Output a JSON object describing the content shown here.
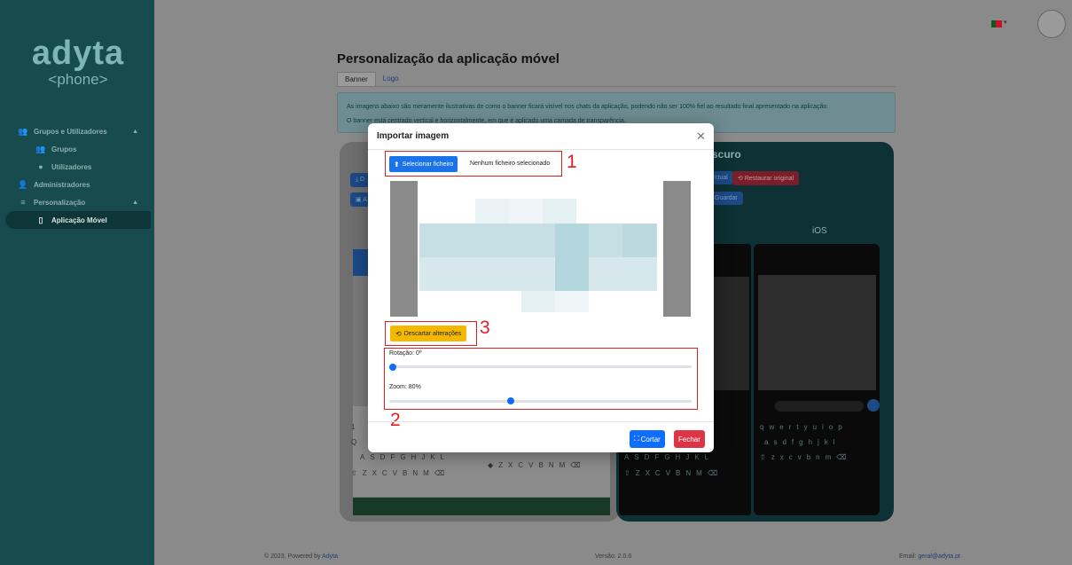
{
  "sidebar": {
    "logo_brand": "adyta",
    "logo_sub": "<phone>",
    "items": [
      {
        "label": "Grupos e Utilizadores",
        "icon": "users-icon"
      },
      {
        "label": "Grupos",
        "icon": "group-icon"
      },
      {
        "label": "Utilizadores",
        "icon": "user-icon"
      },
      {
        "label": "Administradores",
        "icon": "admin-icon"
      },
      {
        "label": "Personalização",
        "icon": "sliders-icon"
      },
      {
        "label": "Aplicação Móvel",
        "icon": "mobile-icon"
      }
    ]
  },
  "header": {
    "title": "Personalização da aplicação móvel",
    "tabs": [
      {
        "label": "Banner"
      },
      {
        "label": "Logo"
      }
    ]
  },
  "info": {
    "line1": "As imagens abaixo são meramente ilustrativas de como o banner ficará visível nos chats da aplicação, podendo não ser 100% fiel ao resultado final apresentado na aplicação.",
    "line2": "O banner está centrado vertical e horizontalmente, em que é aplicado uma camada de transparência."
  },
  "preview": {
    "dark_title": "Modo escuro",
    "ios_title": "iOS",
    "btn_current": "ctual",
    "btn_restore": "Restaurar original",
    "btn_save": "Guardar",
    "btn_d": "D",
    "btn_a": "A"
  },
  "modal": {
    "title": "Importar imagem",
    "file_button": "Selecionar ficheiro",
    "file_status": "Nenhum ficheiro selecionado",
    "discard_button": "Descartar alterações",
    "rotation_label": "Rotação: 0º",
    "rotation_value": 0,
    "zoom_label": "Zoom: 80%",
    "zoom_value": 80,
    "crop_button": "Cortar",
    "close_button": "Fechar",
    "annotations": [
      "1",
      "2",
      "3"
    ]
  },
  "footer": {
    "copyright": "© 2023, Powered by",
    "brand_link": "Adyta",
    "version": "Versão: 2.0.6",
    "email_label": "Email:",
    "email": "geral@adyta.pt"
  },
  "colors": {
    "sidebar": "#174b4e",
    "primary": "#0d6efd",
    "warning": "#f5b800",
    "danger": "#dc3545",
    "annotation": "#e02020"
  }
}
